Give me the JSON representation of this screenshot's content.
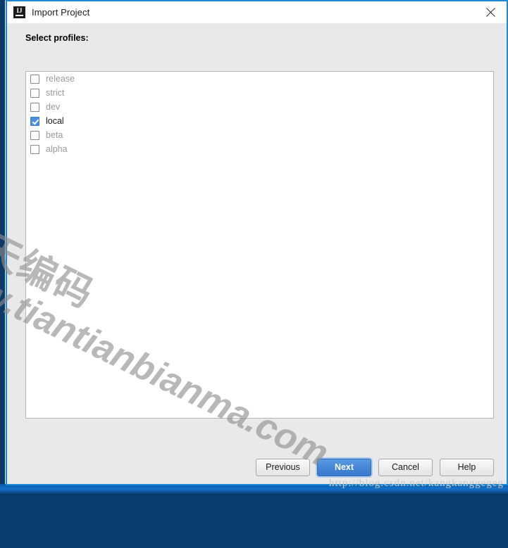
{
  "window": {
    "title": "Import Project",
    "app_icon": "intellij-idea-icon",
    "icon_letters": "IJ",
    "close_label": "×",
    "border_color": "#1e8ad6"
  },
  "content": {
    "section_label": "Select profiles:",
    "profiles": [
      {
        "label": "release",
        "checked": false
      },
      {
        "label": "strict",
        "checked": false
      },
      {
        "label": "dev",
        "checked": false
      },
      {
        "label": "local",
        "checked": true
      },
      {
        "label": "beta",
        "checked": false
      },
      {
        "label": "alpha",
        "checked": false
      }
    ]
  },
  "footer": {
    "previous_label": "Previous",
    "next_label": "Next",
    "cancel_label": "Cancel",
    "help_label": "Help",
    "primary_button": "Next",
    "primary_color": "#4485d6"
  },
  "watermarks": {
    "chinese": "天天编码",
    "site": "www.tiantianbianma.com",
    "csdn": "http://blog.csdn.net/kangkanggegeg"
  }
}
